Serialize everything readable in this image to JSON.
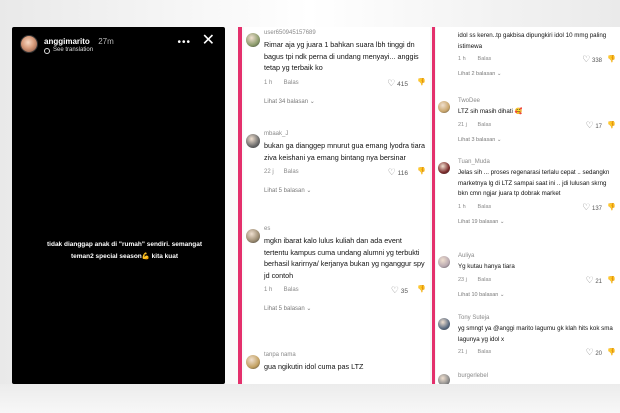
{
  "story": {
    "username": "anggimarito",
    "time": "27m",
    "translate": "See translation",
    "dots": "•••",
    "close": "✕",
    "text": "tidak dianggap anak di \"rumah\" sendiri. semangat teman2 special season💪 kita kuat"
  },
  "col1": [
    {
      "user": "user650945157689",
      "text": "Rimar aja yg juara 1 bahkan suara lbh tinggi dn bagus tpi ndk perna di undang menyayi... anggis tetap yg terbaik ko",
      "time": "1 h",
      "reply": "Balas",
      "likes": "415",
      "view": "Lihat 34 balasan ⌄",
      "avatar": "#8a9a6a"
    },
    {
      "user": "mbaak_J",
      "text": "bukan ga dianggep mnurut gua emang lyodra tiara ziva keishani ya emang bintang nya bersinar",
      "time": "22 j",
      "reply": "Balas",
      "likes": "116",
      "view": "Lihat 5 balasan ⌄",
      "avatar": "#6a6a6a"
    },
    {
      "user": "es",
      "text": "mgkn ibarat kalo lulus kuliah dan ada event tertentu kampus cuma undang alumni yg terbukti berhasil karirnya/ kerjanya bukan yg nganggur spy jd contoh",
      "time": "1 h",
      "reply": "Balas",
      "likes": "35",
      "view": "Lihat 5 balasan ⌄",
      "avatar": "#9a8a70"
    },
    {
      "user": "tanpa nama",
      "text": "gua ngikutin idol cuma pas LTZ",
      "time": "",
      "reply": "",
      "likes": "",
      "view": "",
      "avatar": "#c2a060"
    }
  ],
  "col2": [
    {
      "user": "",
      "text": "idol ss keren..tp gakbisa dipungkiri idol 10 mmg paling istimewa",
      "time": "1 h",
      "reply": "Balas",
      "likes": "338",
      "view": "Lihat 2 balasan ⌄",
      "avatar": "#ffffff"
    },
    {
      "user": "TwoDee",
      "text": "LTZ sih masih dihati 🥰",
      "time": "21 j",
      "reply": "Balas",
      "likes": "17",
      "view": "Lihat 3 balasan ⌄",
      "avatar": "#c9a56a"
    },
    {
      "user": "Tuan_Muda",
      "text": "Jelas sih ... proses regenarasi terlalu cepat .. sedangkn marketnya lg di LTZ sampai saat ini .. jdi lulusan skrng bkn cmn ngjar juara tp dobrak market",
      "time": "1 h",
      "reply": "Balas",
      "likes": "137",
      "view": "Lihat 19 balasan ⌄",
      "avatar": "#7a2a2a"
    },
    {
      "user": "Auliya",
      "text": "Yg kutau hanya tiara",
      "time": "23 j",
      "reply": "Balas",
      "likes": "21",
      "view": "Lihat 10 balasan ⌄",
      "avatar": "#b8a8b0"
    },
    {
      "user": "Tony Suteja",
      "text": "yg smngt ya @anggi marito lagumu gk klah hits kok sma lagunya yg idol x",
      "time": "21 j",
      "reply": "Balas",
      "likes": "20",
      "view": "",
      "avatar": "#5a6a80"
    },
    {
      "user": "burgerlebel",
      "text": "",
      "time": "",
      "reply": "",
      "likes": "",
      "view": "",
      "avatar": "#8a8a8a"
    }
  ]
}
